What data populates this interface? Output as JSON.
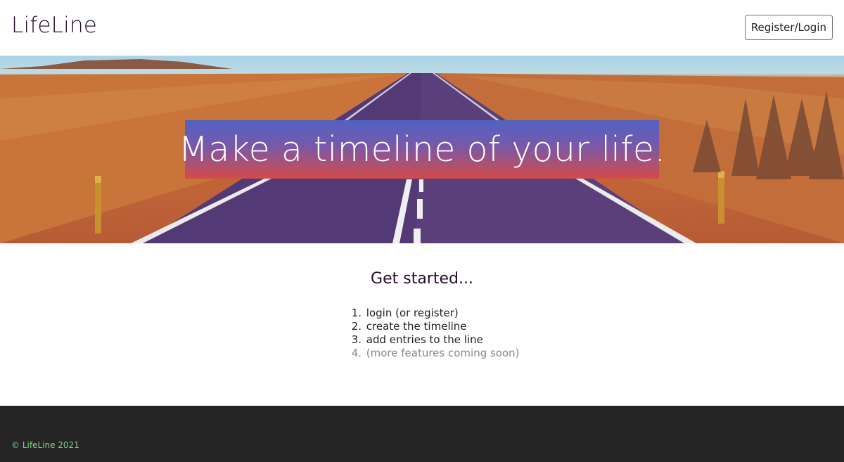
{
  "header": {
    "brand": "LifeLine",
    "auth_button": "Register/Login"
  },
  "hero": {
    "headline": "Make a timeline of your life."
  },
  "main": {
    "heading": "Get started...",
    "steps": [
      {
        "number": "1.",
        "text": "login (or register)"
      },
      {
        "number": "2.",
        "text": "create the timeline"
      },
      {
        "number": "3.",
        "text": "add entries to the line"
      },
      {
        "number": "4.",
        "text": "(more features coming soon)"
      }
    ]
  },
  "footer": {
    "copyright": "© LifeLine 2021"
  },
  "colors": {
    "brand_text": "#2a0d2a",
    "footer_bg": "#252525",
    "footer_text": "#7fd08a",
    "hero_gradient_top": "#4f63c4",
    "hero_gradient_bottom": "#d44b48"
  }
}
